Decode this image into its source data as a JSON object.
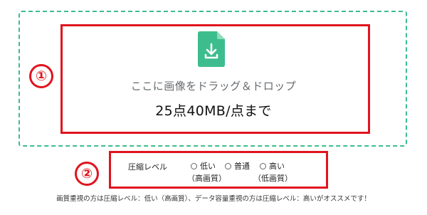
{
  "dropzone": {
    "icon": "file-download-icon",
    "text": "ここに画像をドラッグ＆ドロップ",
    "limit": "25点40MB/点まで"
  },
  "markers": {
    "first": "①",
    "second": "②"
  },
  "compression": {
    "label": "圧縮レベル",
    "options": [
      {
        "label": "低い",
        "sub": "（高画質）"
      },
      {
        "label": "普通"
      },
      {
        "label": "高い",
        "sub": "（低画質）"
      }
    ]
  },
  "footnote": "画質重視の方は圧縮レベル：低い（高画質）、データ容量重視の方は圧縮レベル：高いがオススメです！",
  "colors": {
    "accent": "#3dbd8d",
    "highlight": "#e0141e"
  }
}
